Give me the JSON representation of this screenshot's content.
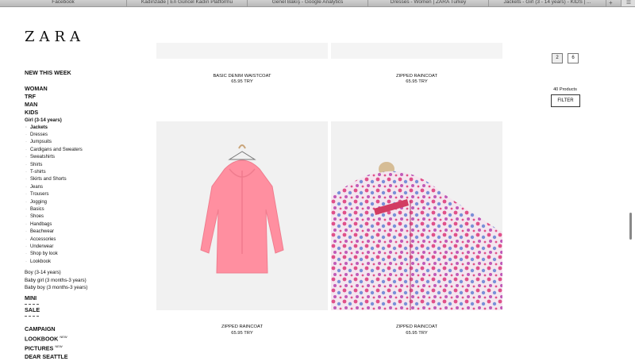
{
  "browser": {
    "tabs": [
      "Facebook",
      "Kadınzade | En Güncel Kadın Platformu",
      "Genel Bakış - Google Analytics",
      "Dresses - Women | ZARA Turkey",
      "Jackets - Girl (3 - 14 years) - KIDS | ..."
    ],
    "new_tab": "+",
    "menu": "☰"
  },
  "logo": "ZARA",
  "sidebar": {
    "new_this_week": "NEW THIS WEEK",
    "sections": [
      "WOMAN",
      "TRF",
      "MAN",
      "KIDS"
    ],
    "girl_heading": "Girl (3-14 years)",
    "girl_items": [
      "Jackets",
      "Dresses",
      "Jumpsuits",
      "Cardigans and Sweaters",
      "Sweatshirts",
      "Shirts",
      "T-shirts",
      "Skirts and Shorts",
      "Jeans",
      "Trousers",
      "Jogging",
      "Basics",
      "Shoes",
      "Handbags",
      "Beachwear",
      "Accessories",
      "Underwear",
      "Shop by look",
      "Lookbook"
    ],
    "kids_other": [
      "Boy (3-14 years)",
      "Baby girl (3 months-3 years)",
      "Baby boy (3 months-3 years)"
    ],
    "mini": "MINI",
    "sale": "SALE",
    "bottom": [
      "CAMPAIGN",
      "LOOKBOOK",
      "PICTURES",
      "DEAR SEATTLE"
    ],
    "new_badge": "NEW"
  },
  "products": [
    {
      "name": "BASIC DENIM WAISTCOAT",
      "price": "65.95 TRY"
    },
    {
      "name": "ZIPPED RAINCOAT",
      "price": "65.95 TRY"
    },
    {
      "name": "ZIPPED RAINCOAT",
      "price": "65.95 TRY"
    },
    {
      "name": "ZIPPED RAINCOAT",
      "price": "65.95 TRY"
    }
  ],
  "controls": {
    "view_options": [
      "2",
      "6"
    ],
    "product_count": "40 Products",
    "filter_label": "FILTER"
  },
  "colors": {
    "jacket_pink": "#ff8fa0",
    "floral_pink": "#e0508a",
    "floral_blue": "#7a8fd8",
    "image_bg": "#f1f1f1"
  }
}
